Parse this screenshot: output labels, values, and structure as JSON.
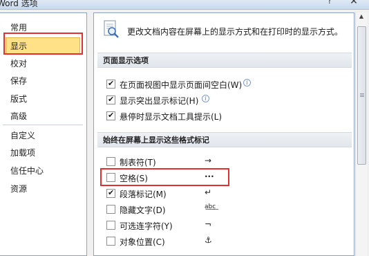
{
  "window": {
    "title": "Word 选项",
    "help_label": "?",
    "close_label": "✕"
  },
  "sidebar": {
    "items": [
      {
        "label": "常用"
      },
      {
        "label": "显示",
        "selected": true
      },
      {
        "label": "校对"
      },
      {
        "label": "保存"
      },
      {
        "label": "版式"
      },
      {
        "label": "高级"
      },
      {
        "label": "自定义"
      },
      {
        "label": "加载项"
      },
      {
        "label": "信任中心"
      },
      {
        "label": "资源"
      }
    ]
  },
  "content": {
    "header_text": "更改文档内容在屏幕上的显示方式和在打印时的显示方式。",
    "sections": [
      {
        "title": "页面显示选项",
        "options": [
          {
            "label": "在页面视图中显示页面间空白(W)",
            "checked": true,
            "info": true
          },
          {
            "label": "显示突出显示标记(H)",
            "checked": true,
            "info": true
          },
          {
            "label": "悬停时显示文档工具提示(L)",
            "checked": true
          }
        ]
      },
      {
        "title": "始终在屏幕上显示这些格式标记",
        "options": [
          {
            "label": "制表符(T)",
            "checked": false,
            "symbol": "→"
          },
          {
            "label": "空格(S)",
            "checked": false,
            "symbol": "···"
          },
          {
            "label": "段落标记(M)",
            "checked": true,
            "symbol": "↵"
          },
          {
            "label": "隐藏文字(D)",
            "checked": false,
            "symbol": "a͟b͟c͟"
          },
          {
            "label": "可选连字符(Y)",
            "checked": false,
            "symbol": "¬"
          },
          {
            "label": "对象位置(C)",
            "checked": false,
            "symbol": "⚓"
          }
        ]
      }
    ]
  },
  "info_icon_glyph": "i",
  "colors": {
    "selected_bg": "#ffe187",
    "highlight_box": "#e03030"
  }
}
